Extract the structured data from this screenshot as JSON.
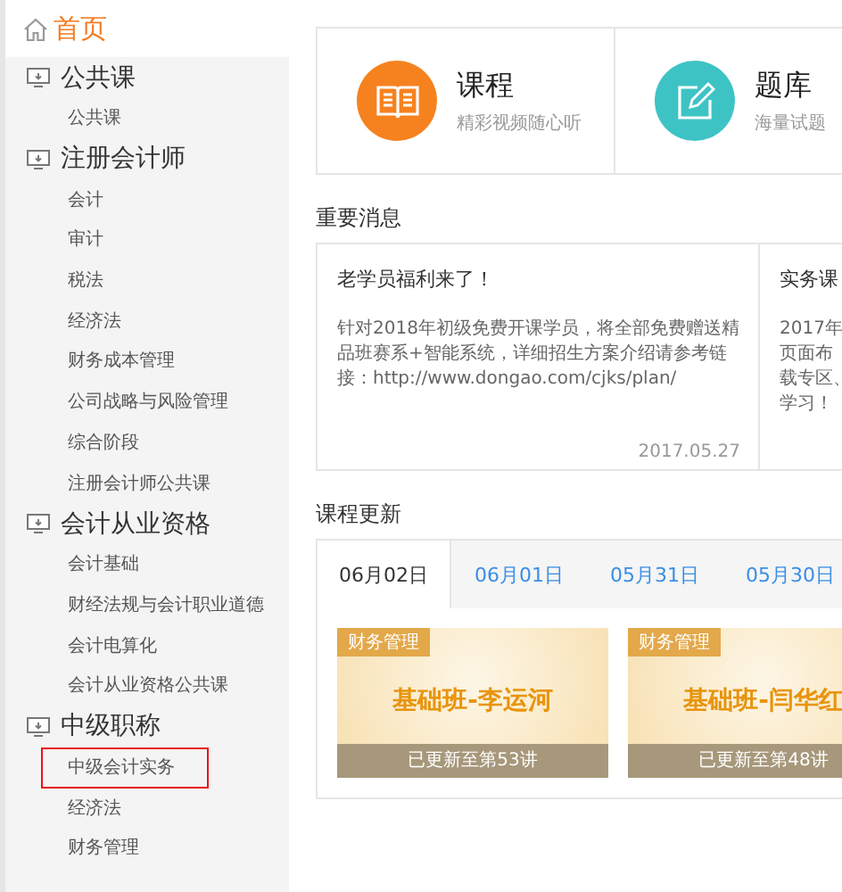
{
  "sidebar": {
    "home": {
      "label": "首页",
      "selected": true
    },
    "sections": [
      {
        "title": "公共课",
        "items": [
          {
            "label": "公共课",
            "selected": false
          }
        ]
      },
      {
        "title": "注册会计师",
        "items": [
          {
            "label": "会计",
            "selected": false
          },
          {
            "label": "审计",
            "selected": false
          },
          {
            "label": "税法",
            "selected": false
          },
          {
            "label": "经济法",
            "selected": false
          },
          {
            "label": "财务成本管理",
            "selected": false
          },
          {
            "label": "公司战略与风险管理",
            "selected": false
          },
          {
            "label": "综合阶段",
            "selected": false
          },
          {
            "label": "注册会计师公共课",
            "selected": false
          }
        ]
      },
      {
        "title": "会计从业资格",
        "items": [
          {
            "label": "会计基础",
            "selected": false
          },
          {
            "label": "财经法规与会计职业道德",
            "selected": false
          },
          {
            "label": "会计电算化",
            "selected": false
          },
          {
            "label": "会计从业资格公共课",
            "selected": false
          }
        ]
      },
      {
        "title": "中级职称",
        "items": [
          {
            "label": "中级会计实务",
            "selected": true
          },
          {
            "label": "经济法",
            "selected": false
          },
          {
            "label": "财务管理",
            "selected": false
          }
        ]
      }
    ]
  },
  "features": [
    {
      "kind": "course",
      "title": "课程",
      "subtitle": "精彩视频随心听"
    },
    {
      "kind": "quiz",
      "title": "题库",
      "subtitle": "海量试题"
    }
  ],
  "news": {
    "title": "重要消息",
    "items": [
      {
        "title": "老学员福利来了！",
        "body": "针对2018年初级免费开课学员，将全部免费赠送精品班赛系+智能系统，详细招生方案介绍请参考链接：http://www.dongao.com/cjks/plan/",
        "date": "2017.05.27"
      },
      {
        "title": "实务课",
        "body_lines": [
          "2017年",
          "页面布",
          "载专区、",
          "学习！"
        ]
      }
    ]
  },
  "updates": {
    "title": "课程更新",
    "tabs": [
      {
        "label": "06月02日",
        "selected": true
      },
      {
        "label": "06月01日",
        "selected": false
      },
      {
        "label": "05月31日",
        "selected": false
      },
      {
        "label": "05月30日",
        "selected": false
      }
    ],
    "courses": [
      {
        "tag": "财务管理",
        "title": "基础班-李运河",
        "progress": "已更新至第53讲"
      },
      {
        "tag": "财务管理",
        "title": "基础班-闫华红",
        "progress": "已更新至第48讲"
      }
    ]
  }
}
